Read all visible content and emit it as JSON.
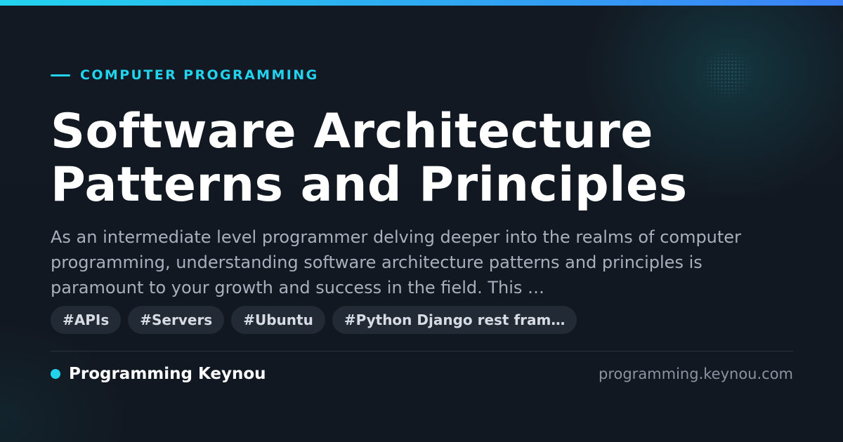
{
  "category": "COMPUTER PROGRAMMING",
  "title_line1": "Software Architecture",
  "title_line2": "Patterns and Principles",
  "description": "As an intermediate level programmer delving deeper into the realms of computer programming, understanding software architecture patterns and principles is paramount to your growth and success in the field. This …",
  "tags": [
    "#APIs",
    "#Servers",
    "#Ubuntu",
    "#Python Django rest fram…"
  ],
  "brand": "Programming Keynou",
  "domain": "programming.keynou.com",
  "colors": {
    "accent": "#22d3ee",
    "accent_gradient_end": "#3b82f6",
    "background": "#121821"
  }
}
